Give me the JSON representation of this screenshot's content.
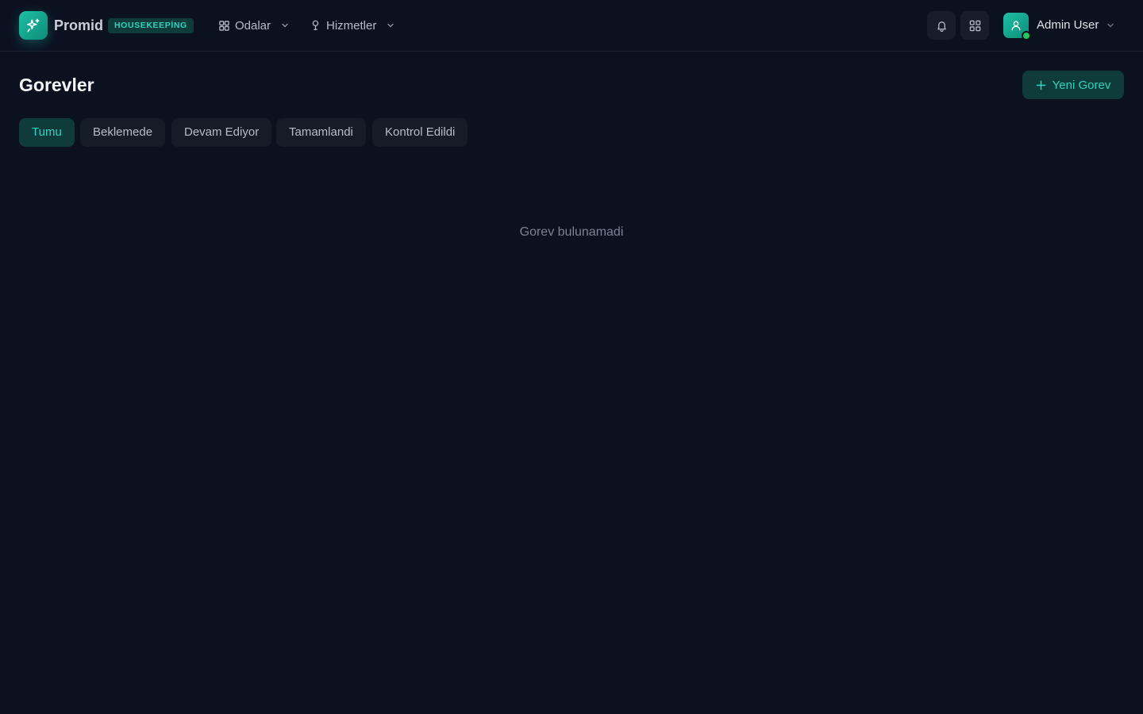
{
  "brand": {
    "name": "Promid",
    "badge": "HOUSEKEEPİNG"
  },
  "nav": [
    {
      "label": "Odalar",
      "icon": "grid-icon"
    },
    {
      "label": "Hizmetler",
      "icon": "pin-icon"
    }
  ],
  "user": {
    "name": "Admin User",
    "status": "online"
  },
  "page": {
    "title": "Gorevler",
    "new_button": "Yeni Gorev"
  },
  "tabs": [
    {
      "label": "Tumu",
      "active": true
    },
    {
      "label": "Beklemede",
      "active": false
    },
    {
      "label": "Devam Ediyor",
      "active": false
    },
    {
      "label": "Tamamlandi",
      "active": false
    },
    {
      "label": "Kontrol Edildi",
      "active": false
    }
  ],
  "empty_state": "Gorev bulunamadi",
  "colors": {
    "background": "#0c1120",
    "accent": "#2dd4bf",
    "accent_bg": "#0f3b3a",
    "online": "#22c55e"
  }
}
